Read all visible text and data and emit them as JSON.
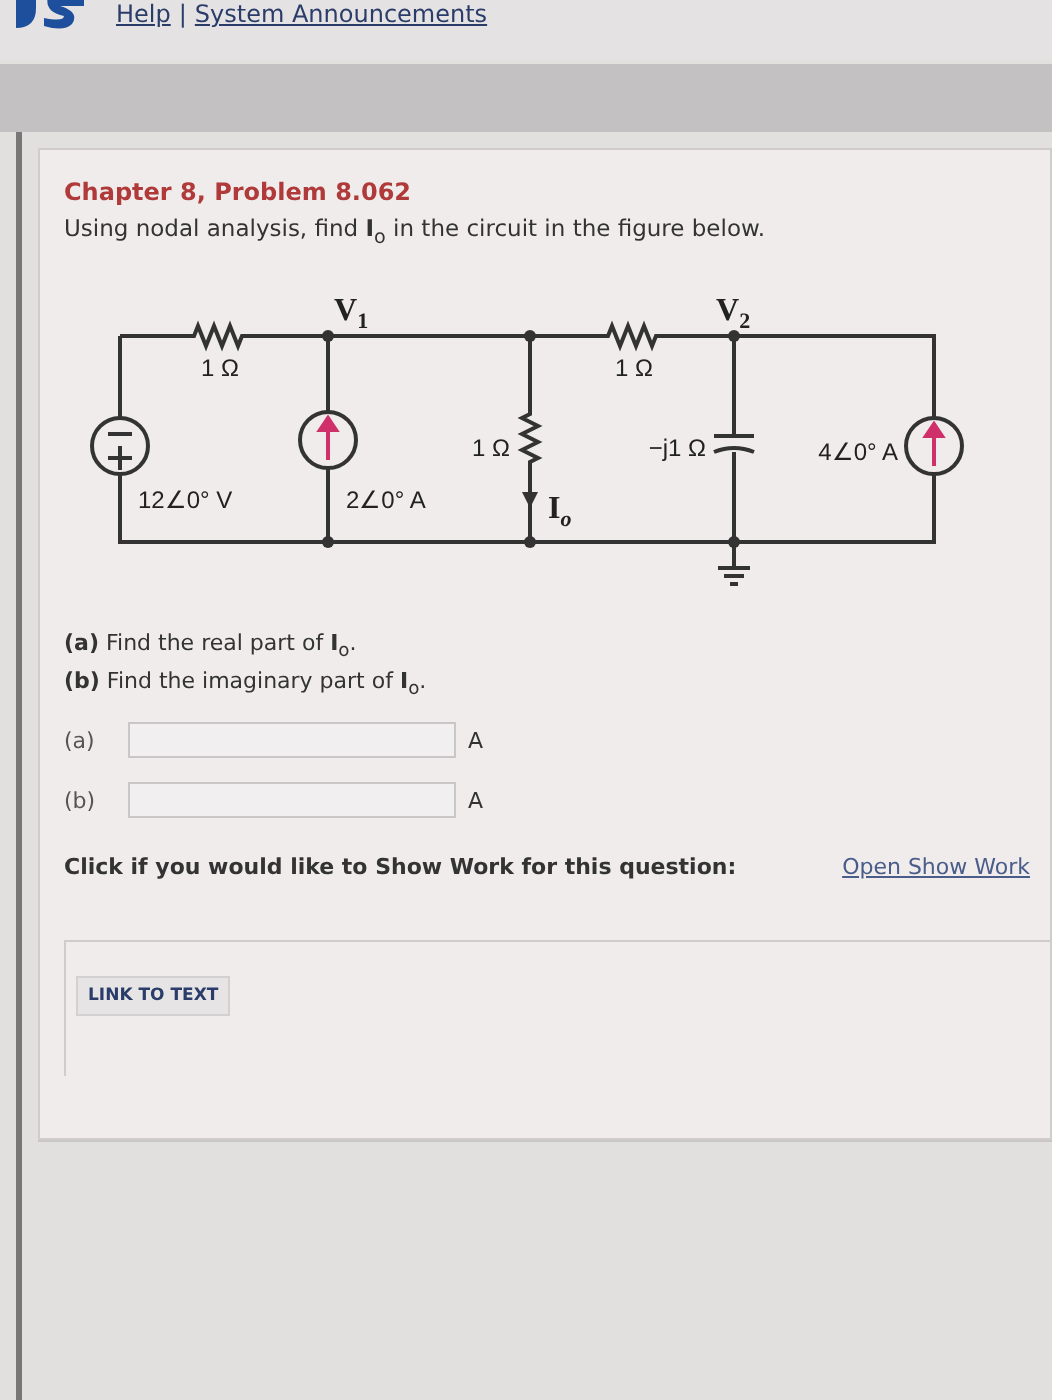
{
  "header": {
    "links": [
      "Help",
      "System Announcements"
    ],
    "separator": "|"
  },
  "problem": {
    "title": "Chapter 8, Problem 8.062",
    "prompt": "Using nodal analysis, find **I**$_{o}$ in the circuit in the figure below."
  },
  "circuit": {
    "node_1": {
      "text": "V",
      "sub": "1"
    },
    "node_2": {
      "text": "V",
      "sub": "2"
    },
    "resistor_left": {
      "text": "1 Ω"
    },
    "resistor_right": {
      "text": "1 Ω"
    },
    "resistor_middle": {
      "text": "1 Ω"
    },
    "capacitor": {
      "text": "−j1 Ω"
    },
    "voltage_source": {
      "text": "12∠0° V"
    },
    "current_source_left": {
      "text": "2∠0° A"
    },
    "current_source_right": {
      "text": "4∠0° A"
    },
    "branch_current": {
      "text": "I",
      "sub": "o"
    }
  },
  "questions": [
    "**(a)** Find the real part of **I**$_{o}$.",
    "**(b)** Find the imaginary part of **I**$_{o}$."
  ],
  "answers": [
    {
      "label": "(a)",
      "unit": "A"
    },
    {
      "label": "(b)",
      "unit": "A"
    }
  ],
  "show_work": {
    "prompt": "Click if you would like to Show Work for this question:",
    "link": "Open Show Work"
  },
  "link_button": "LINK TO TEXT"
}
